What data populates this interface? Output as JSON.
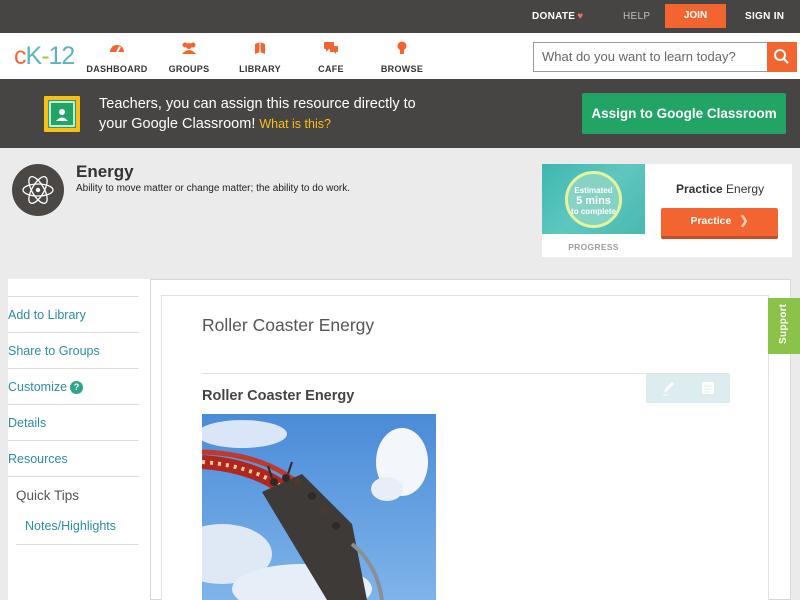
{
  "topbar": {
    "donate": "DONATE",
    "help": "HELP",
    "join": "JOIN",
    "signin": "SIGN IN"
  },
  "logo": {
    "c": "c",
    "k": "K",
    "dash": "-",
    "num": "12"
  },
  "nav": [
    {
      "label": "DASHBOARD",
      "icon": "dashboard-icon"
    },
    {
      "label": "GROUPS",
      "icon": "groups-icon"
    },
    {
      "label": "LIBRARY",
      "icon": "library-icon"
    },
    {
      "label": "CAFE",
      "icon": "cafe-icon"
    },
    {
      "label": "BROWSE",
      "icon": "browse-icon"
    }
  ],
  "search": {
    "placeholder": "What do you want to learn today?"
  },
  "classroom_banner": {
    "line1": "Teachers, you can assign this resource directly to",
    "line2": "your Google Classroom!",
    "what": "What is this?",
    "button": "Assign to Google Classroom"
  },
  "concept": {
    "title": "Energy",
    "description": "Ability to move matter or change matter; the ability to do work."
  },
  "practice": {
    "circle_line1": "Estimated",
    "circle_line2": "5 mins",
    "circle_line3": "to complete",
    "progress_label": "PROGRESS",
    "title_bold": "Practice",
    "title_rest": "Energy",
    "button": "Practice"
  },
  "sidebar": {
    "items": [
      {
        "label": "Add to Library"
      },
      {
        "label": "Share to Groups"
      },
      {
        "label": "Customize"
      },
      {
        "label": "Details"
      },
      {
        "label": "Resources"
      }
    ],
    "quick_tips": "Quick Tips",
    "notes": "Notes/Highlights"
  },
  "article": {
    "title": "Roller Coaster Energy",
    "subtitle": "Roller Coaster Energy"
  },
  "support": "Support",
  "colors": {
    "accent": "#f26531",
    "classroom_green": "#21a464",
    "link": "#2c8da0",
    "dark_bar": "#474543"
  }
}
